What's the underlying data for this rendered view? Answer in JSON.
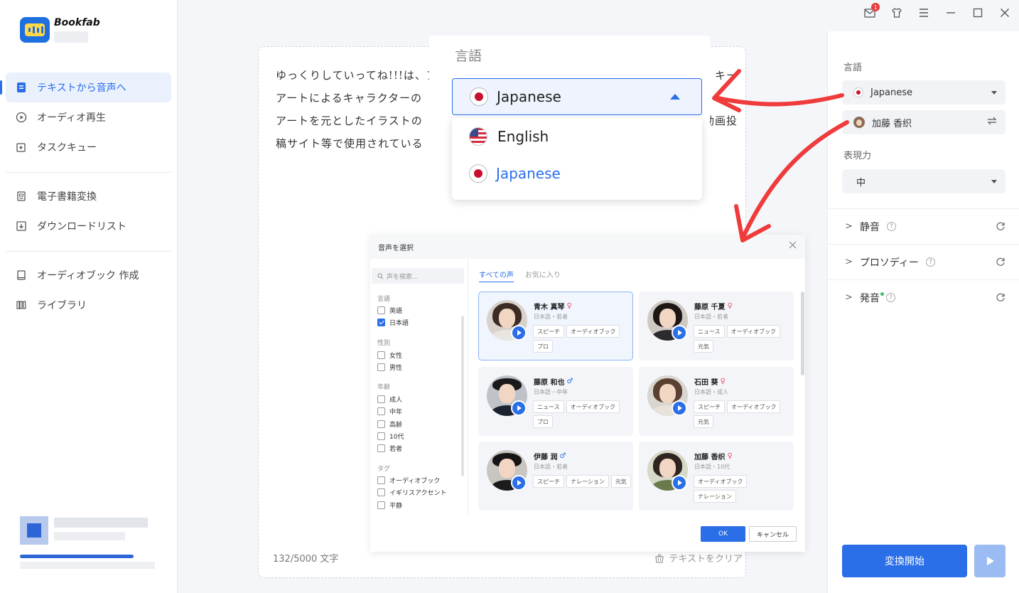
{
  "app": {
    "logo_text": "Bookfab"
  },
  "titlebar": {
    "mail_badge": "1"
  },
  "sidebar": {
    "items": [
      {
        "label": "テキストから音声へ"
      },
      {
        "label": "オーディオ再生"
      },
      {
        "label": "タスクキュー"
      },
      {
        "label": "電子書籍変換"
      },
      {
        "label": "ダウンロードリスト"
      },
      {
        "label": "オーディオブック 作成"
      },
      {
        "label": "ライブラリ"
      }
    ]
  },
  "editor": {
    "text_lines": [
      "ゆっくりしていってね!!!は、ア",
      "アートによるキャラクターの",
      "アートを元としたイラストの",
      "稿サイト等で使用されている"
    ],
    "text_right": [
      "キー",
      "",
      "動画投",
      ""
    ],
    "char_count": "132/5000 文字",
    "clear_label": "テキストをクリア"
  },
  "language_popup": {
    "title": "言語",
    "selected": "Japanese",
    "options": [
      "English",
      "Japanese"
    ]
  },
  "right_panel": {
    "language_label": "言語",
    "language_value": "Japanese",
    "voice_value": "加藤 香织",
    "expression_label": "表現力",
    "expression_value": "中",
    "sections": [
      "静音",
      "プロソディー",
      "発音"
    ],
    "convert_label": "変換開始"
  },
  "voice_dialog": {
    "title": "音声を選択",
    "search_placeholder": "声を検索...",
    "tabs": [
      "すべての声",
      "お気に入り"
    ],
    "filters": {
      "language_label": "言語",
      "languages": [
        "英語",
        "日本語"
      ],
      "gender_label": "性別",
      "genders": [
        "女性",
        "男性"
      ],
      "age_label": "年齢",
      "ages": [
        "成人",
        "中年",
        "高齢",
        "10代",
        "若者"
      ],
      "tag_label": "タグ",
      "tags": [
        "オーディオブック",
        "イギリスアクセント",
        "平静"
      ]
    },
    "voices": [
      {
        "name": "青木 真琴",
        "gender": "♀",
        "meta": "日本語・若者",
        "tags": [
          "スピーチ",
          "オーディオブック",
          "プロ"
        ]
      },
      {
        "name": "藤原 千夏",
        "gender": "♀",
        "meta": "日本語・若者",
        "tags": [
          "ニュース",
          "オーディオブック",
          "元気"
        ]
      },
      {
        "name": "藤原 和也",
        "gender": "♂",
        "meta": "日本語・中年",
        "tags": [
          "ニュース",
          "オーディオブック",
          "プロ"
        ]
      },
      {
        "name": "石田 葵",
        "gender": "♀",
        "meta": "日本語・成人",
        "tags": [
          "スピーチ",
          "オーディオブック",
          "元気"
        ]
      },
      {
        "name": "伊藤 润",
        "gender": "♂",
        "meta": "日本語・若者",
        "tags": [
          "スピーチ",
          "ナレーション",
          "元気"
        ]
      },
      {
        "name": "加藤 香织",
        "gender": "♀",
        "meta": "日本語・10代",
        "tags": [
          "オーディオブック",
          "ナレーション"
        ]
      }
    ],
    "ok_label": "OK",
    "cancel_label": "キャンセル"
  },
  "colors": {
    "accent": "#2a6ee8",
    "arrow": "#ef3b3b"
  }
}
